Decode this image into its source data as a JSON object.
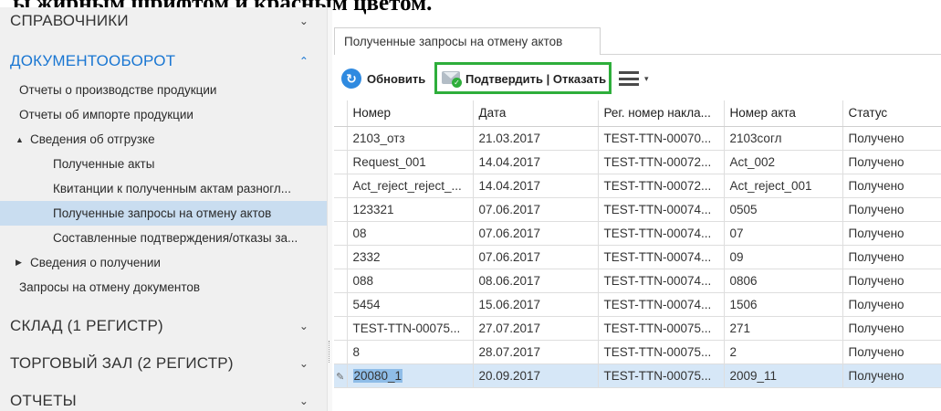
{
  "heading": "ы жирным шрифтом и красным цветом.",
  "sidebar": {
    "sections": [
      {
        "label": "СПРАВОЧНИКИ",
        "chevron": "chevron-down"
      },
      {
        "label": "ДОКУМЕНТООБОРОТ",
        "chevron": "chevron-up"
      },
      {
        "label": "СКЛАД (1 РЕГИСТР)",
        "chevron": "chevron-down"
      },
      {
        "label": "ТОРГОВЫЙ ЗАЛ (2 РЕГИСТР)",
        "chevron": "chevron-down"
      },
      {
        "label": "ОТЧЕТЫ",
        "chevron": "chevron-down"
      }
    ],
    "items": [
      {
        "label": "Отчеты о производстве продукции"
      },
      {
        "label": "Отчеты об импорте продукции"
      },
      {
        "label": "Сведения об отгрузке",
        "toggle": "▲"
      },
      {
        "label": "Полученные акты"
      },
      {
        "label": "Квитанции к полученным актам разногл..."
      },
      {
        "label": "Полученные запросы на отмену актов"
      },
      {
        "label": "Составленные подтверждения/отказы за..."
      },
      {
        "label": "Сведения о получении",
        "toggle": "▶"
      },
      {
        "label": "Запросы на отмену документов"
      }
    ]
  },
  "tab": {
    "label": "Полученные запросы на отмену актов"
  },
  "toolbar": {
    "refresh_label": "Обновить",
    "confirm_label": "Подтвердить | Отказать",
    "refresh_icon": "↻",
    "caret": "▾"
  },
  "colors": {
    "accent": "#1976d2",
    "highlight_border": "#2eae3b",
    "selected_row": "#d6e7f7",
    "selected_nav": "#c9ddf0"
  },
  "grid": {
    "columns": [
      "Номер",
      "Дата",
      "Рег. номер накла...",
      "Номер акта",
      "Статус"
    ],
    "rows": [
      [
        "2103_отз",
        "21.03.2017",
        "TEST-TTN-00070...",
        "2103согл",
        "Получено"
      ],
      [
        "Request_001",
        "14.04.2017",
        "TEST-TTN-00072...",
        "Act_002",
        "Получено"
      ],
      [
        "Act_reject_reject_...",
        "14.04.2017",
        "TEST-TTN-00072...",
        "Act_reject_001",
        "Получено"
      ],
      [
        "123321",
        "07.06.2017",
        "TEST-TTN-00074...",
        "0505",
        "Получено"
      ],
      [
        "08",
        "07.06.2017",
        "TEST-TTN-00074...",
        "07",
        "Получено"
      ],
      [
        "2332",
        "07.06.2017",
        "TEST-TTN-00074...",
        "09",
        "Получено"
      ],
      [
        "088",
        "08.06.2017",
        "TEST-TTN-00074...",
        "0806",
        "Получено"
      ],
      [
        "5454",
        "15.06.2017",
        "TEST-TTN-00074...",
        "1506",
        "Получено"
      ],
      [
        "TEST-TTN-00075...",
        "27.07.2017",
        "TEST-TTN-00075...",
        "271",
        "Получено"
      ],
      [
        "8",
        "28.07.2017",
        "TEST-TTN-00075...",
        "2",
        "Получено"
      ],
      [
        "20080_1",
        "20.09.2017",
        "TEST-TTN-00075...",
        "2009_11",
        "Получено"
      ]
    ],
    "selected_row_index": 10
  }
}
